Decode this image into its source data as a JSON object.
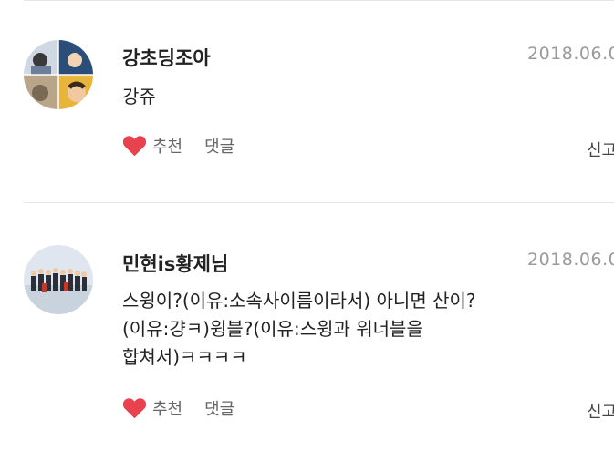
{
  "comments": [
    {
      "author": "강초딩조아",
      "date": "2018.06.0",
      "body": "강쥬",
      "like_label": "추천",
      "like_count": "",
      "reply_label": "댓글",
      "reply_count": "",
      "report_label": "신고",
      "avatar_desc": "avatar-collage",
      "like_icon": "heart-icon",
      "like_color": "#e8424e"
    },
    {
      "author": "민현is황제님",
      "date": "2018.06.0",
      "body_lines": [
        "스윙이?(이유:소속사이름이라서) 아니면 산이?",
        "(이유:걍ㅋ)윙블?(이유:스윙과 워너블을",
        "합쳐서)ㅋㅋㅋㅋ"
      ],
      "like_label": "추천",
      "like_count": "",
      "reply_label": "댓글",
      "reply_count": "",
      "report_label": "신고",
      "avatar_desc": "avatar-group-photo",
      "like_icon": "heart-icon",
      "like_color": "#e8424e"
    }
  ]
}
